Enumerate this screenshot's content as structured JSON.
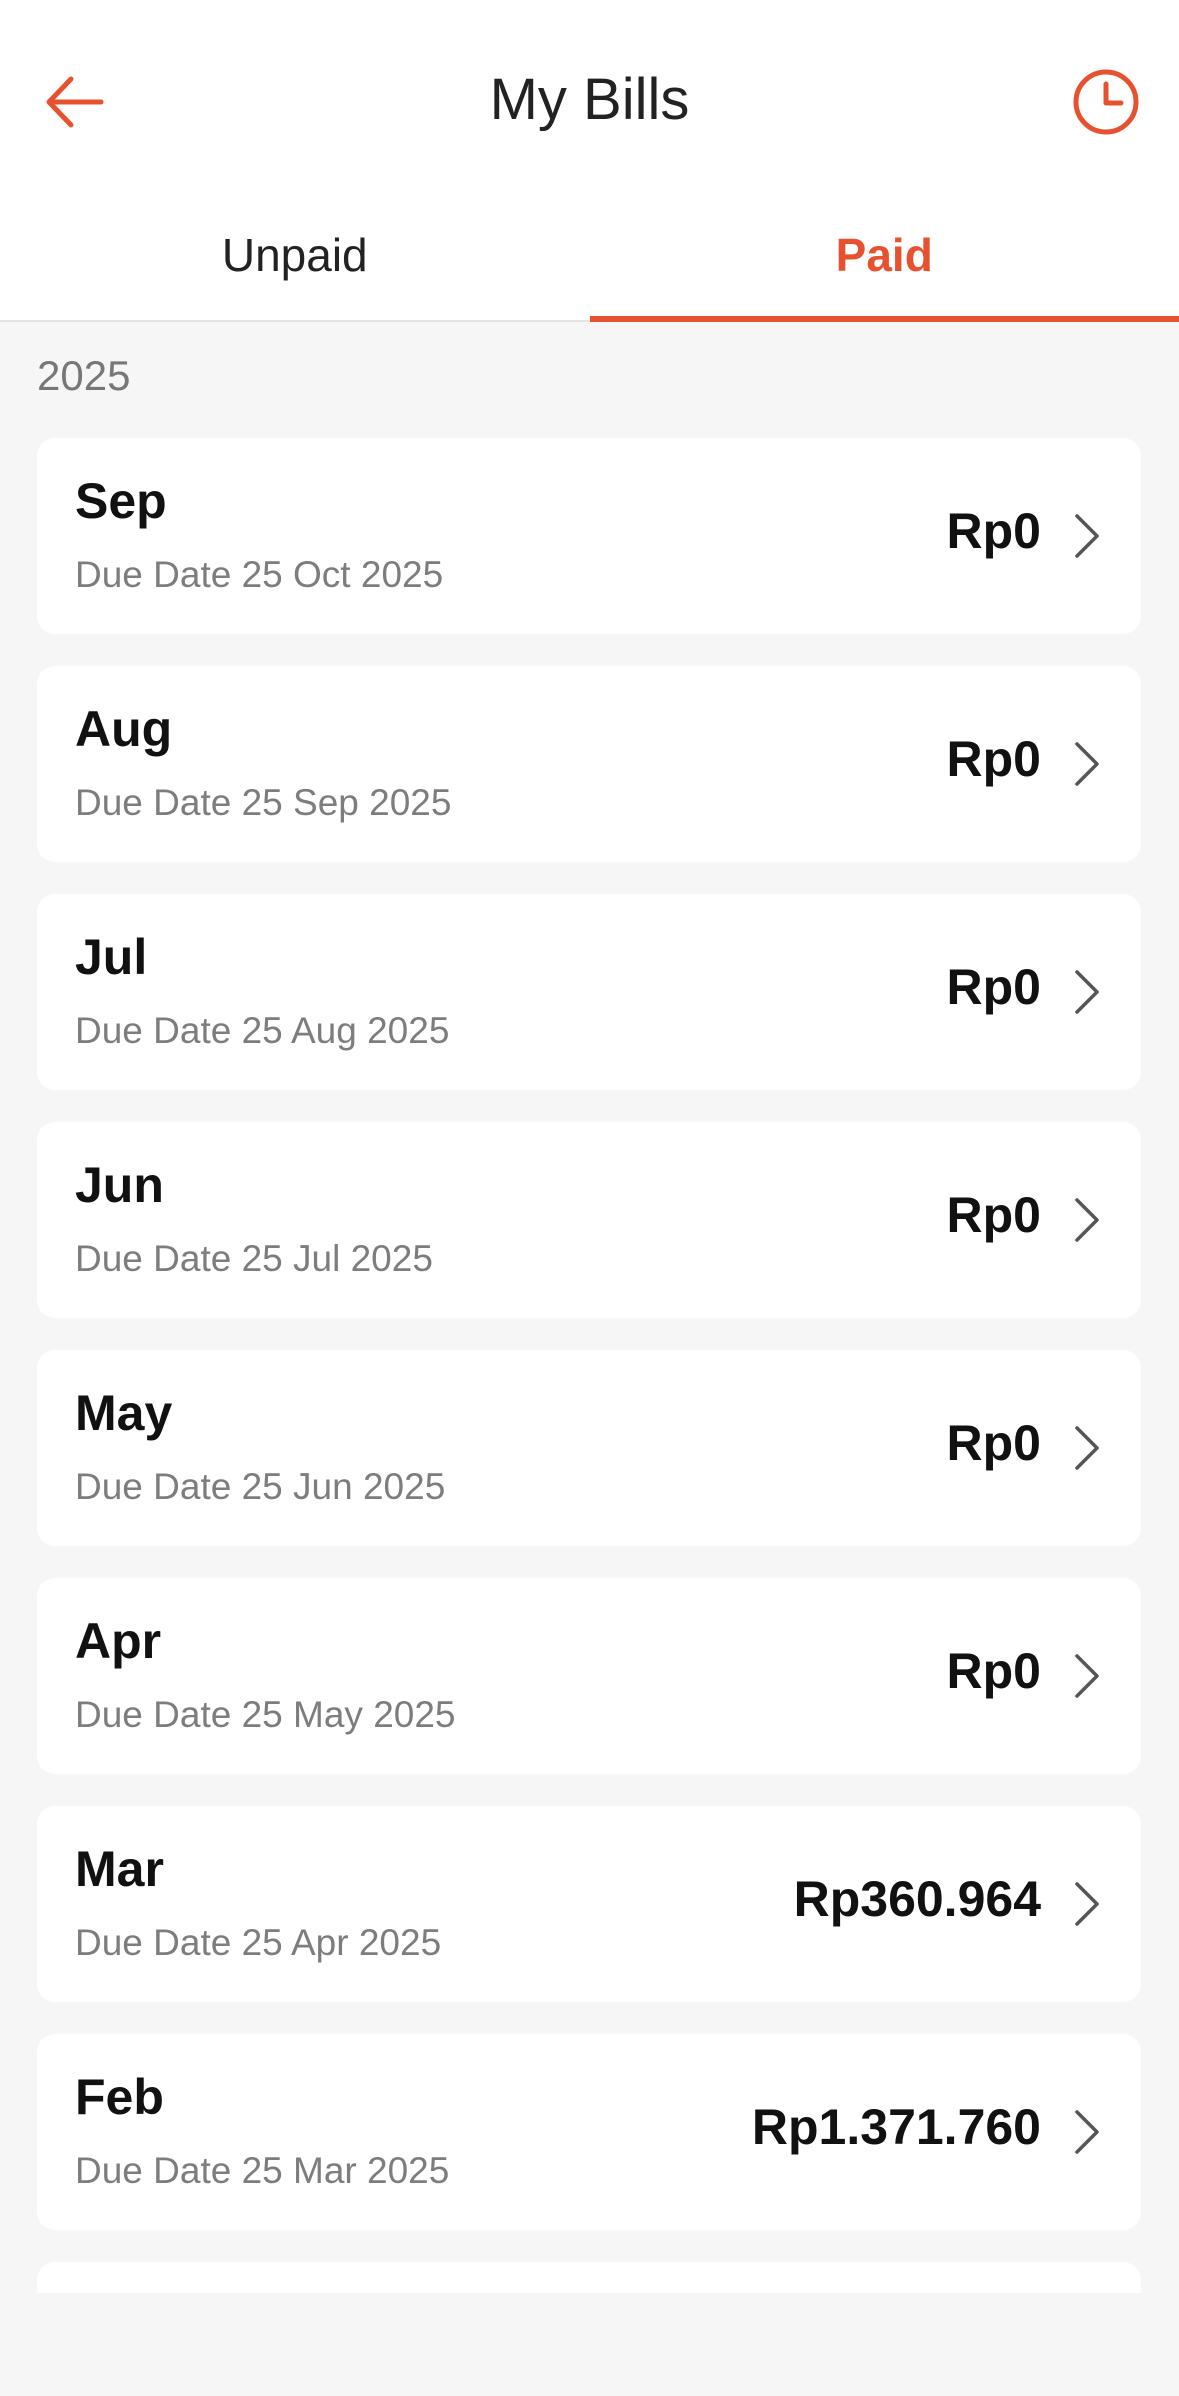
{
  "header": {
    "title": "My Bills",
    "back_icon": "arrow-left-icon",
    "history_icon": "clock-icon",
    "accent_color": "#e8512f"
  },
  "tabs": [
    {
      "label": "Unpaid",
      "active": false
    },
    {
      "label": "Paid",
      "active": true
    }
  ],
  "year": "2025",
  "bills": [
    {
      "month": "Sep",
      "due": "Due Date 25 Oct 2025",
      "amount": "Rp0"
    },
    {
      "month": "Aug",
      "due": "Due Date 25 Sep 2025",
      "amount": "Rp0"
    },
    {
      "month": "Jul",
      "due": "Due Date 25 Aug 2025",
      "amount": "Rp0"
    },
    {
      "month": "Jun",
      "due": "Due Date 25 Jul 2025",
      "amount": "Rp0"
    },
    {
      "month": "May",
      "due": "Due Date 25 Jun 2025",
      "amount": "Rp0"
    },
    {
      "month": "Apr",
      "due": "Due Date 25 May 2025",
      "amount": "Rp0"
    },
    {
      "month": "Mar",
      "due": "Due Date 25 Apr 2025",
      "amount": "Rp360.964"
    },
    {
      "month": "Feb",
      "due": "Due Date 25 Mar 2025",
      "amount": "Rp1.371.760"
    }
  ]
}
